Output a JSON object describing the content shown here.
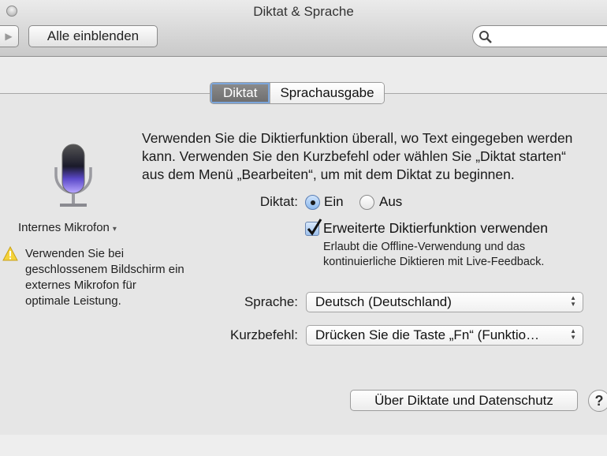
{
  "window": {
    "title": "Diktat & Sprache"
  },
  "toolbar": {
    "show_all_label": "Alle einblenden",
    "search_placeholder": ""
  },
  "tabs": [
    {
      "label": "Diktat",
      "active": true
    },
    {
      "label": "Sprachausgabe",
      "active": false
    }
  ],
  "microphone": {
    "label": "Internes Mikrofon",
    "arrow": "▾"
  },
  "warning": {
    "text": "Verwenden Sie bei\ngeschlossenem Bildschirm ein\nexternes Mikrofon für\noptimale Leistung."
  },
  "intro": "Verwenden Sie die Diktierfunktion überall, wo Text eingegeben werden\nkann. Verwenden Sie den Kurzbefehl oder wählen Sie „Diktat starten“\naus dem Menü „Bearbeiten“, um mit dem Diktat zu beginnen.",
  "dictation": {
    "label": "Diktat:",
    "on_label": "Ein",
    "off_label": "Aus",
    "selected": "Ein"
  },
  "enhanced": {
    "label": "Erweiterte Diktierfunktion verwenden",
    "checked": true,
    "description": "Erlaubt die Offline-Verwendung und das\nkontinuierliche Diktieren mit Live-Feedback."
  },
  "language": {
    "label": "Sprache:",
    "value": "Deutsch (Deutschland)"
  },
  "shortcut": {
    "label": "Kurzbefehl:",
    "value": "Drücken Sie die Taste „Fn“ (Funktio…"
  },
  "footer": {
    "about_label": "Über Diktate und Datenschutz",
    "help_label": "?"
  },
  "colors": {
    "accent": "#7ca6db",
    "mic_glow": "#8a6cf0"
  }
}
